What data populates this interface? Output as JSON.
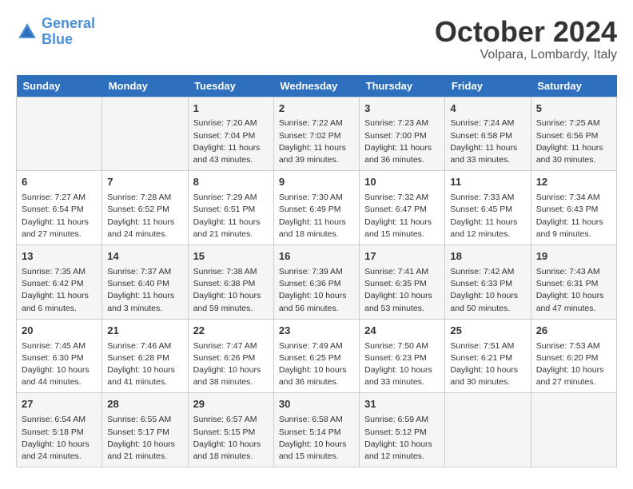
{
  "header": {
    "logo_general": "General",
    "logo_blue": "Blue",
    "month": "October 2024",
    "location": "Volpara, Lombardy, Italy"
  },
  "days_of_week": [
    "Sunday",
    "Monday",
    "Tuesday",
    "Wednesday",
    "Thursday",
    "Friday",
    "Saturday"
  ],
  "weeks": [
    [
      {
        "day": "",
        "info": ""
      },
      {
        "day": "",
        "info": ""
      },
      {
        "day": "1",
        "info": "Sunrise: 7:20 AM\nSunset: 7:04 PM\nDaylight: 11 hours and 43 minutes."
      },
      {
        "day": "2",
        "info": "Sunrise: 7:22 AM\nSunset: 7:02 PM\nDaylight: 11 hours and 39 minutes."
      },
      {
        "day": "3",
        "info": "Sunrise: 7:23 AM\nSunset: 7:00 PM\nDaylight: 11 hours and 36 minutes."
      },
      {
        "day": "4",
        "info": "Sunrise: 7:24 AM\nSunset: 6:58 PM\nDaylight: 11 hours and 33 minutes."
      },
      {
        "day": "5",
        "info": "Sunrise: 7:25 AM\nSunset: 6:56 PM\nDaylight: 11 hours and 30 minutes."
      }
    ],
    [
      {
        "day": "6",
        "info": "Sunrise: 7:27 AM\nSunset: 6:54 PM\nDaylight: 11 hours and 27 minutes."
      },
      {
        "day": "7",
        "info": "Sunrise: 7:28 AM\nSunset: 6:52 PM\nDaylight: 11 hours and 24 minutes."
      },
      {
        "day": "8",
        "info": "Sunrise: 7:29 AM\nSunset: 6:51 PM\nDaylight: 11 hours and 21 minutes."
      },
      {
        "day": "9",
        "info": "Sunrise: 7:30 AM\nSunset: 6:49 PM\nDaylight: 11 hours and 18 minutes."
      },
      {
        "day": "10",
        "info": "Sunrise: 7:32 AM\nSunset: 6:47 PM\nDaylight: 11 hours and 15 minutes."
      },
      {
        "day": "11",
        "info": "Sunrise: 7:33 AM\nSunset: 6:45 PM\nDaylight: 11 hours and 12 minutes."
      },
      {
        "day": "12",
        "info": "Sunrise: 7:34 AM\nSunset: 6:43 PM\nDaylight: 11 hours and 9 minutes."
      }
    ],
    [
      {
        "day": "13",
        "info": "Sunrise: 7:35 AM\nSunset: 6:42 PM\nDaylight: 11 hours and 6 minutes."
      },
      {
        "day": "14",
        "info": "Sunrise: 7:37 AM\nSunset: 6:40 PM\nDaylight: 11 hours and 3 minutes."
      },
      {
        "day": "15",
        "info": "Sunrise: 7:38 AM\nSunset: 6:38 PM\nDaylight: 10 hours and 59 minutes."
      },
      {
        "day": "16",
        "info": "Sunrise: 7:39 AM\nSunset: 6:36 PM\nDaylight: 10 hours and 56 minutes."
      },
      {
        "day": "17",
        "info": "Sunrise: 7:41 AM\nSunset: 6:35 PM\nDaylight: 10 hours and 53 minutes."
      },
      {
        "day": "18",
        "info": "Sunrise: 7:42 AM\nSunset: 6:33 PM\nDaylight: 10 hours and 50 minutes."
      },
      {
        "day": "19",
        "info": "Sunrise: 7:43 AM\nSunset: 6:31 PM\nDaylight: 10 hours and 47 minutes."
      }
    ],
    [
      {
        "day": "20",
        "info": "Sunrise: 7:45 AM\nSunset: 6:30 PM\nDaylight: 10 hours and 44 minutes."
      },
      {
        "day": "21",
        "info": "Sunrise: 7:46 AM\nSunset: 6:28 PM\nDaylight: 10 hours and 41 minutes."
      },
      {
        "day": "22",
        "info": "Sunrise: 7:47 AM\nSunset: 6:26 PM\nDaylight: 10 hours and 38 minutes."
      },
      {
        "day": "23",
        "info": "Sunrise: 7:49 AM\nSunset: 6:25 PM\nDaylight: 10 hours and 36 minutes."
      },
      {
        "day": "24",
        "info": "Sunrise: 7:50 AM\nSunset: 6:23 PM\nDaylight: 10 hours and 33 minutes."
      },
      {
        "day": "25",
        "info": "Sunrise: 7:51 AM\nSunset: 6:21 PM\nDaylight: 10 hours and 30 minutes."
      },
      {
        "day": "26",
        "info": "Sunrise: 7:53 AM\nSunset: 6:20 PM\nDaylight: 10 hours and 27 minutes."
      }
    ],
    [
      {
        "day": "27",
        "info": "Sunrise: 6:54 AM\nSunset: 5:18 PM\nDaylight: 10 hours and 24 minutes."
      },
      {
        "day": "28",
        "info": "Sunrise: 6:55 AM\nSunset: 5:17 PM\nDaylight: 10 hours and 21 minutes."
      },
      {
        "day": "29",
        "info": "Sunrise: 6:57 AM\nSunset: 5:15 PM\nDaylight: 10 hours and 18 minutes."
      },
      {
        "day": "30",
        "info": "Sunrise: 6:58 AM\nSunset: 5:14 PM\nDaylight: 10 hours and 15 minutes."
      },
      {
        "day": "31",
        "info": "Sunrise: 6:59 AM\nSunset: 5:12 PM\nDaylight: 10 hours and 12 minutes."
      },
      {
        "day": "",
        "info": ""
      },
      {
        "day": "",
        "info": ""
      }
    ]
  ]
}
